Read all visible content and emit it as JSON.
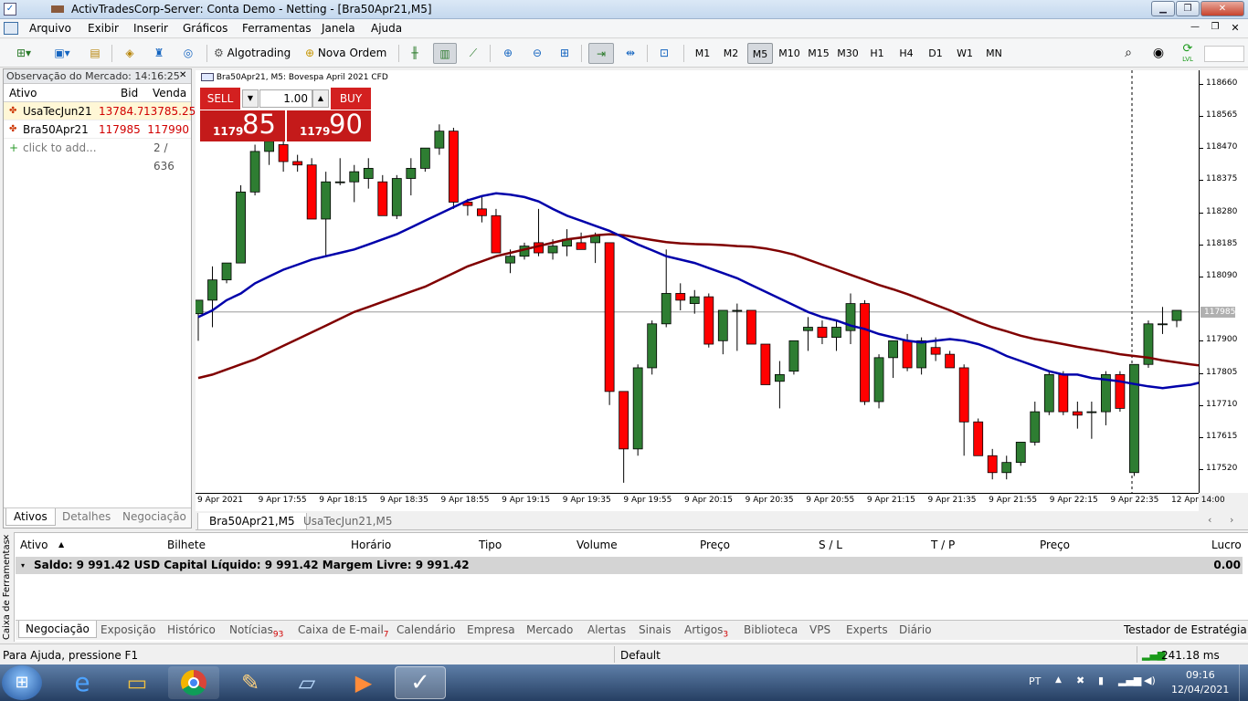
{
  "window": {
    "title": "ActivTradesCorp-Server: Conta Demo - Netting - [Bra50Apr21,M5]"
  },
  "menu": [
    "Arquivo",
    "Exibir",
    "Inserir",
    "Gráficos",
    "Ferramentas",
    "Janela",
    "Ajuda"
  ],
  "toolbar": {
    "algotrading": "Algotrading",
    "new_order": "Nova Ordem",
    "timeframes": [
      "M1",
      "M2",
      "M5",
      "M10",
      "M15",
      "M30",
      "H1",
      "H4",
      "D1",
      "W1",
      "MN"
    ],
    "active_timeframe": "M5",
    "lvl": "LVL"
  },
  "market_watch": {
    "title": "Observação do Mercado: 14:16:25",
    "col_symbol": "Ativo",
    "col_bid": "Bid",
    "col_ask": "Venda",
    "rows": [
      {
        "symbol": "UsaTecJun21",
        "bid": "13784.75",
        "ask": "13785.25"
      },
      {
        "symbol": "Bra50Apr21",
        "bid": "117985",
        "ask": "117990"
      }
    ],
    "add": "click to add...",
    "count": "2 / 636",
    "tabs": [
      "Ativos",
      "Detalhes",
      "Negociação"
    ]
  },
  "chart": {
    "title": "Bra50Apr21, M5:  Bovespa April 2021 CFD",
    "trade": {
      "sell": "SELL",
      "buy": "BUY",
      "volume": "1.00",
      "sell_big": "1179",
      "sell_small": "85",
      "buy_big": "1179",
      "buy_small": "90"
    },
    "current_price": "117985",
    "colors": {
      "bull": "#2e7d32",
      "bear": "#ff0000",
      "ma_fast": "#0000aa",
      "ma_slow": "#800000"
    }
  },
  "chart_data": {
    "type": "candlestick",
    "y_ticks": [
      118660,
      118565,
      118470,
      118375,
      118280,
      118185,
      118090,
      117900,
      117805,
      117710,
      117615,
      117520
    ],
    "ylim": [
      117450,
      118700
    ],
    "x_tick_labels": [
      "9 Apr 2021",
      "9 Apr 17:55",
      "9 Apr 18:15",
      "9 Apr 18:35",
      "9 Apr 18:55",
      "9 Apr 19:15",
      "9 Apr 19:35",
      "9 Apr 19:55",
      "9 Apr 20:15",
      "9 Apr 20:35",
      "9 Apr 20:55",
      "9 Apr 21:15",
      "9 Apr 21:35",
      "9 Apr 21:55",
      "9 Apr 22:15",
      "9 Apr 22:35",
      "12 Apr 14:00"
    ],
    "candles": [
      [
        117980,
        118020,
        117900,
        118020
      ],
      [
        118020,
        118120,
        117940,
        118080
      ],
      [
        118080,
        118130,
        118070,
        118130
      ],
      [
        118130,
        118360,
        118140,
        118340
      ],
      [
        118340,
        118480,
        118330,
        118460
      ],
      [
        118460,
        118510,
        118420,
        118490
      ],
      [
        118480,
        118490,
        118400,
        118430
      ],
      [
        118430,
        118450,
        118400,
        118420
      ],
      [
        118420,
        118440,
        118260,
        118260
      ],
      [
        118260,
        118400,
        118150,
        118370
      ],
      [
        118370,
        118440,
        118360,
        118370
      ],
      [
        118370,
        118420,
        118310,
        118400
      ],
      [
        118380,
        118440,
        118350,
        118410
      ],
      [
        118370,
        118390,
        118270,
        118270
      ],
      [
        118270,
        118390,
        118260,
        118380
      ],
      [
        118380,
        118440,
        118330,
        118410
      ],
      [
        118410,
        118460,
        118400,
        118470
      ],
      [
        118470,
        118540,
        118450,
        118520
      ],
      [
        118520,
        118530,
        118290,
        118310
      ],
      [
        118310,
        118320,
        118270,
        118300
      ],
      [
        118290,
        118330,
        118250,
        118270
      ],
      [
        118270,
        118290,
        118180,
        118160
      ],
      [
        118130,
        118170,
        118100,
        118150
      ],
      [
        118150,
        118190,
        118140,
        118180
      ],
      [
        118190,
        118290,
        118150,
        118160
      ],
      [
        118160,
        118200,
        118140,
        118180
      ],
      [
        118180,
        118230,
        118150,
        118200
      ],
      [
        118190,
        118220,
        118170,
        118170
      ],
      [
        118190,
        118220,
        118130,
        118210
      ],
      [
        118190,
        118190,
        117710,
        117750
      ],
      [
        117750,
        117750,
        117480,
        117580
      ],
      [
        117580,
        117830,
        117560,
        117820
      ],
      [
        117820,
        117960,
        117800,
        117950
      ],
      [
        117950,
        118170,
        117940,
        118040
      ],
      [
        118040,
        118070,
        117990,
        118020
      ],
      [
        118010,
        118050,
        117980,
        118030
      ],
      [
        118030,
        118040,
        117880,
        117890
      ],
      [
        117900,
        117990,
        117860,
        117990
      ],
      [
        117990,
        118010,
        117870,
        117990
      ],
      [
        117990,
        117990,
        117890,
        117890
      ],
      [
        117890,
        117890,
        117770,
        117770
      ],
      [
        117780,
        117840,
        117700,
        117800
      ],
      [
        117810,
        117900,
        117800,
        117900
      ],
      [
        117930,
        117970,
        117870,
        117940
      ],
      [
        117940,
        117960,
        117890,
        117910
      ],
      [
        117910,
        117960,
        117870,
        117940
      ],
      [
        117930,
        118040,
        117890,
        118010
      ],
      [
        118010,
        118020,
        117710,
        117720
      ],
      [
        117720,
        117860,
        117700,
        117850
      ],
      [
        117850,
        117900,
        117790,
        117900
      ],
      [
        117900,
        117920,
        117810,
        117820
      ],
      [
        117820,
        117910,
        117800,
        117900
      ],
      [
        117880,
        117910,
        117840,
        117860
      ],
      [
        117860,
        117870,
        117820,
        117820
      ],
      [
        117820,
        117830,
        117560,
        117660
      ],
      [
        117660,
        117670,
        117560,
        117560
      ],
      [
        117560,
        117580,
        117490,
        117510
      ],
      [
        117510,
        117560,
        117490,
        117540
      ],
      [
        117540,
        117600,
        117530,
        117600
      ],
      [
        117600,
        117720,
        117590,
        117690
      ],
      [
        117690,
        117810,
        117680,
        117800
      ],
      [
        117800,
        117810,
        117680,
        117690
      ],
      [
        117690,
        117720,
        117640,
        117680
      ],
      [
        117690,
        117720,
        117610,
        117690
      ],
      [
        117690,
        117810,
        117650,
        117800
      ],
      [
        117800,
        117810,
        117690,
        117700
      ],
      [
        117510,
        117830,
        117500,
        117830
      ],
      [
        117830,
        117960,
        117820,
        117950
      ],
      [
        117950,
        118000,
        117920,
        117950
      ],
      [
        117960,
        117980,
        117940,
        117990
      ]
    ],
    "ma_fast": [
      117970,
      117990,
      118020,
      118040,
      118070,
      118090,
      118110,
      118125,
      118140,
      118150,
      118160,
      118170,
      118185,
      118200,
      118215,
      118235,
      118255,
      118275,
      118295,
      118315,
      118328,
      118336,
      118332,
      118325,
      118312,
      118290,
      118270,
      118255,
      118240,
      118225,
      118205,
      118185,
      118168,
      118150,
      118140,
      118130,
      118115,
      118100,
      118085,
      118065,
      118045,
      118025,
      118005,
      117985,
      117970,
      117960,
      117945,
      117935,
      117920,
      117910,
      117900,
      117895,
      117900,
      117905,
      117900,
      117890,
      117875,
      117855,
      117840,
      117825,
      117810,
      117800,
      117800,
      117790,
      117785,
      117780,
      117772,
      117765,
      117760,
      117765,
      117770,
      117780,
      117790
    ],
    "ma_slow": [
      117790,
      117800,
      117815,
      117830,
      117845,
      117865,
      117885,
      117905,
      117925,
      117945,
      117965,
      117985,
      118000,
      118015,
      118030,
      118045,
      118060,
      118080,
      118100,
      118120,
      118135,
      118150,
      118160,
      118170,
      118180,
      118190,
      118200,
      118205,
      118212,
      118215,
      118212,
      118205,
      118198,
      118192,
      118188,
      118186,
      118185,
      118183,
      118180,
      118178,
      118173,
      118165,
      118155,
      118140,
      118125,
      118110,
      118095,
      118080,
      118065,
      118052,
      118038,
      118022,
      118006,
      117990,
      117972,
      117955,
      117940,
      117928,
      117915,
      117905,
      117898,
      117890,
      117882,
      117875,
      117868,
      117860,
      117855,
      117850,
      117842,
      117836,
      117830,
      117825
    ]
  },
  "chart_tabs": [
    "Bra50Apr21,M5",
    "UsaTecJun21,M5"
  ],
  "toolbox": {
    "side_label": "Caixa de Ferramentas",
    "columns": [
      "Ativo",
      "Bilhete",
      "Horário",
      "Tipo",
      "Volume",
      "Preço",
      "S / L",
      "T / P",
      "Preço",
      "Lucro"
    ],
    "balance": "Saldo: 9 991.42 USD  Capital Líquido: 9 991.42  Margem Livre: 9 991.42",
    "profit": "0.00",
    "tabs": [
      {
        "label": "Negociação"
      },
      {
        "label": "Exposição"
      },
      {
        "label": "Histórico"
      },
      {
        "label": "Notícias",
        "badge": "93"
      },
      {
        "label": "Caixa de E-mail",
        "badge": "7"
      },
      {
        "label": "Calendário"
      },
      {
        "label": "Empresa"
      },
      {
        "label": "Mercado"
      },
      {
        "label": "Alertas"
      },
      {
        "label": "Sinais"
      },
      {
        "label": "Artigos",
        "badge": "3"
      },
      {
        "label": "Biblioteca"
      },
      {
        "label": "VPS"
      },
      {
        "label": "Experts"
      },
      {
        "label": "Diário"
      }
    ],
    "strategy_tester": "Testador de Estratégia"
  },
  "status": {
    "help": "Para Ajuda, pressione F1",
    "profile": "Default",
    "ping": "241.18 ms"
  },
  "taskbar": {
    "lang": "PT",
    "time": "09:16",
    "date": "12/04/2021"
  }
}
